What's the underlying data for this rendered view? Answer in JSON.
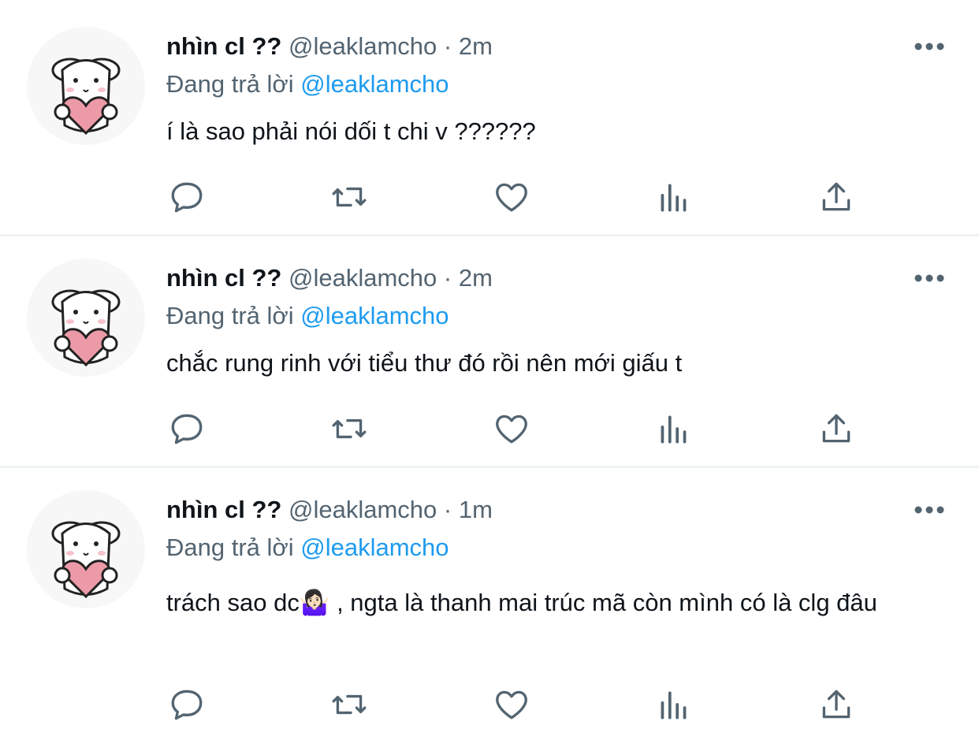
{
  "tweets": [
    {
      "display_name": "nhìn cl ??",
      "handle": "@leaklamcho",
      "separator": "·",
      "time": "2m",
      "reply_prefix": "Đang trả lời",
      "reply_to": "@leaklamcho",
      "text": "í là sao phải nói dối t chi v ??????"
    },
    {
      "display_name": "nhìn cl ??",
      "handle": "@leaklamcho",
      "separator": "·",
      "time": "2m",
      "reply_prefix": "Đang trả lời",
      "reply_to": "@leaklamcho",
      "text": "chắc rung rinh với tiểu thư đó rồi nên mới giấu t"
    },
    {
      "display_name": "nhìn cl ??",
      "handle": "@leaklamcho",
      "separator": "·",
      "time": "1m",
      "reply_prefix": "Đang trả lời",
      "reply_to": "@leaklamcho",
      "text": "trách sao dc🤷🏻‍♀️ , ngta là thanh mai trúc mã còn mình có là clg đâu"
    }
  ],
  "icons": {
    "more": "more-horizontal-icon",
    "reply": "reply-bubble-icon",
    "retweet": "retweet-icon",
    "like": "heart-icon",
    "views": "views-chart-icon",
    "share": "share-upload-icon"
  },
  "colors": {
    "text": "#0f1419",
    "secondary": "#536471",
    "link": "#1d9bf0",
    "divider": "#eff3f4",
    "avatar_heart": "#ec9aa8"
  }
}
